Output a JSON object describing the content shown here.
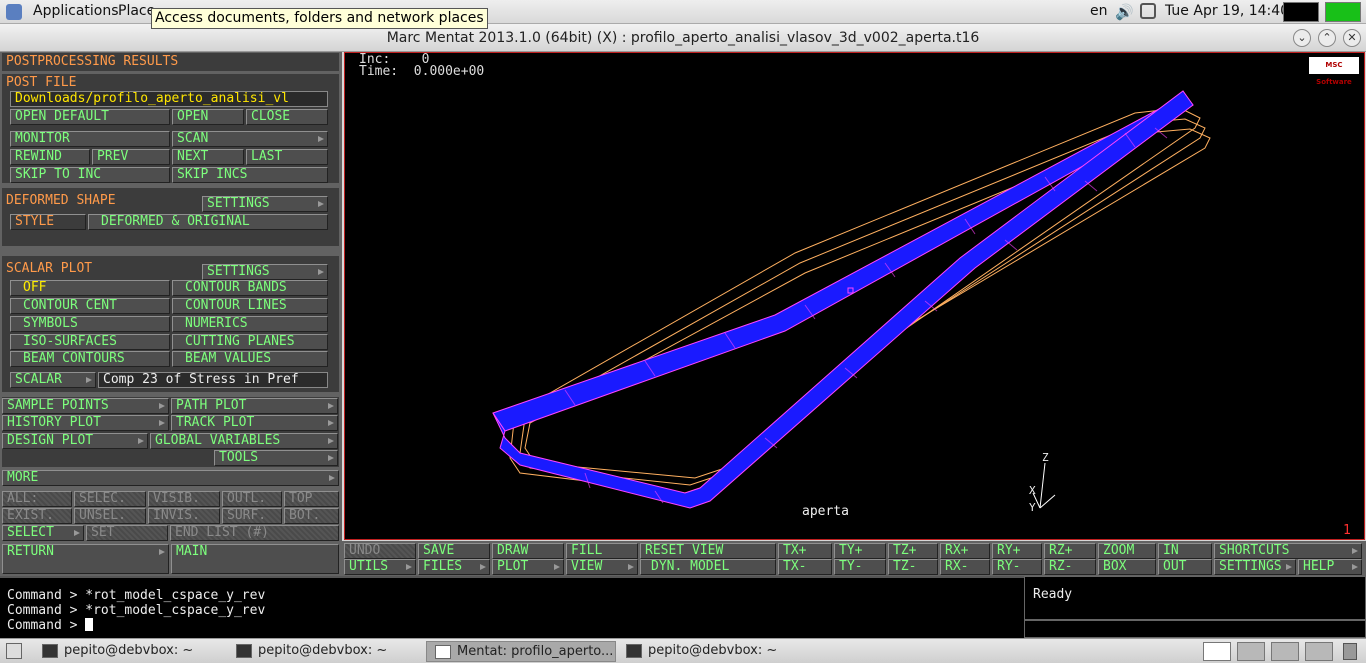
{
  "topbar": {
    "applications": "Applications",
    "places": "Place",
    "tooltip": "Access documents, folders and network places",
    "lang": "en",
    "clock": "Tue Apr 19, 14:40"
  },
  "window": {
    "title": "Marc Mentat 2013.1.0 (64bit) (X) : profilo_aperto_analisi_vlasov_3d_v002_aperta.t16"
  },
  "panel": {
    "header": "POSTPROCESSING RESULTS",
    "post_file": {
      "label": "POST FILE",
      "path": "Downloads/profilo_aperto_analisi_vl",
      "open_default": "OPEN DEFAULT",
      "open": "OPEN",
      "close": "CLOSE",
      "monitor": "MONITOR",
      "scan": "SCAN",
      "rewind": "REWIND",
      "prev": "PREV",
      "next": "NEXT",
      "last": "LAST",
      "skip_to_inc": "SKIP TO INC",
      "skip_incs": "SKIP INCS"
    },
    "deformed": {
      "label": "DEFORMED SHAPE",
      "settings": "SETTINGS",
      "style": "STYLE",
      "style_value": "DEFORMED & ORIGINAL"
    },
    "scalar": {
      "label": "SCALAR PLOT",
      "settings": "SETTINGS",
      "off": "OFF",
      "contour_bands": "CONTOUR BANDS",
      "contour_cent": "CONTOUR CENT",
      "contour_lines": "CONTOUR LINES",
      "symbols": "SYMBOLS",
      "numerics": "NUMERICS",
      "iso_surfaces": "ISO-SURFACES",
      "cutting_planes": "CUTTING PLANES",
      "beam_contours": "BEAM CONTOURS",
      "beam_values": "BEAM VALUES",
      "scalar": "SCALAR",
      "scalar_value": "Comp 23 of Stress in Pref"
    },
    "plots": {
      "sample_points": "SAMPLE POINTS",
      "path_plot": "PATH PLOT",
      "history_plot": "HISTORY PLOT",
      "track_plot": "TRACK PLOT",
      "design_plot": "DESIGN PLOT",
      "global_variables": "GLOBAL VARIABLES",
      "tools": "TOOLS"
    },
    "more": "MORE",
    "disabled": {
      "all": "ALL:",
      "selec": "SELEC.",
      "visib": "VISIB.",
      "outl": "OUTL.",
      "top": "TOP",
      "exist": "EXIST.",
      "unsel": "UNSEL.",
      "invis": "INVIS.",
      "surf": "SURF.",
      "bot": "BOT."
    },
    "select": "SELECT",
    "set": "SET",
    "end_list": "END LIST (#)",
    "return": "RETURN",
    "main": "MAIN"
  },
  "graphics": {
    "inc_label": "Inc:",
    "inc_value": "0",
    "time_label": "Time:",
    "time_value": "0.000e+00",
    "logo": "MSC Software",
    "model_label": "aperta",
    "axis_z": "Z",
    "axis_x": "X",
    "axis_y": "Y",
    "viewport_number": "1",
    "colors": {
      "mesh": "#1a1aff",
      "nodes": "#ff44ff",
      "contour": "#ffb060",
      "border": "#c02020"
    }
  },
  "toolbar": {
    "undo": "UNDO",
    "utils": "UTILS",
    "save": "SAVE",
    "files": "FILES",
    "draw": "DRAW",
    "plot": "PLOT",
    "fill": "FILL",
    "view": "VIEW",
    "reset_view": "RESET VIEW",
    "dyn_model": "DYN. MODEL",
    "tx_plus": "TX+",
    "tx_minus": "TX-",
    "ty_plus": "TY+",
    "ty_minus": "TY-",
    "tz_plus": "TZ+",
    "tz_minus": "TZ-",
    "rx_plus": "RX+",
    "rx_minus": "RX-",
    "ry_plus": "RY+",
    "ry_minus": "RY-",
    "rz_plus": "RZ+",
    "rz_minus": "RZ-",
    "zoom": "ZOOM",
    "box": "BOX",
    "in": "IN",
    "out": "OUT",
    "shortcuts": "SHORTCUTS",
    "settings": "SETTINGS",
    "help": "HELP"
  },
  "command": {
    "line1": "Command > *rot_model_cspace_y_rev",
    "line2": "Command > *rot_model_cspace_y_rev",
    "line3": "Command > "
  },
  "status": "Ready",
  "taskbar": {
    "task1": "pepito@debvbox: ~",
    "task2": "pepito@debvbox: ~",
    "task3": "Mentat: profilo_aperto...",
    "task4": "pepito@debvbox: ~"
  }
}
